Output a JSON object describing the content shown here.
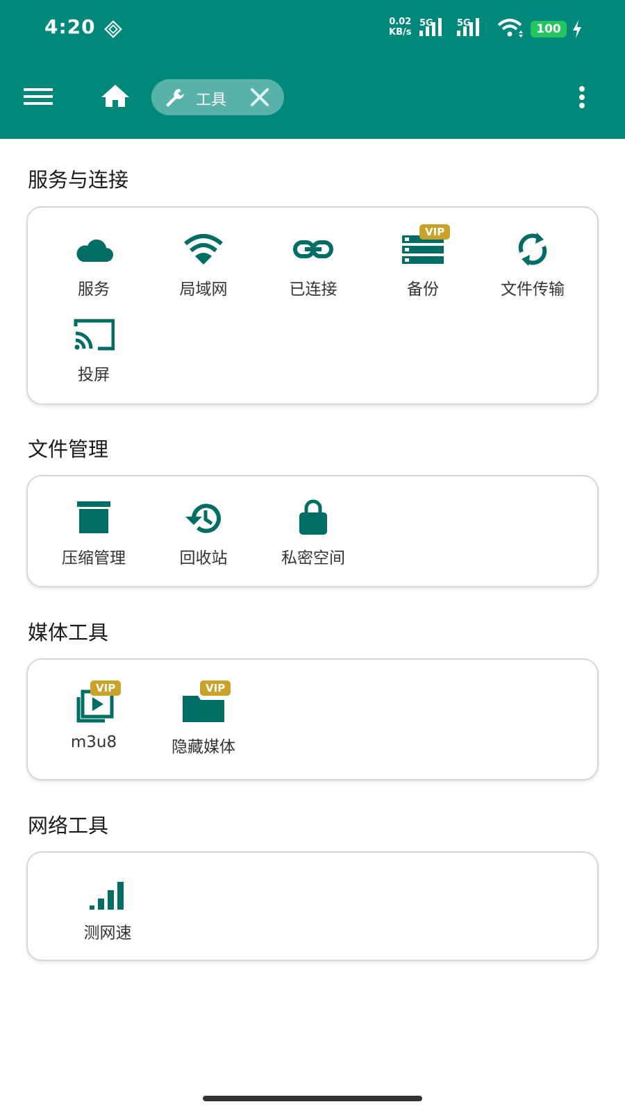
{
  "status_bar": {
    "time": "4:20",
    "net_speed_value": "0.02",
    "net_speed_unit": "KB/s",
    "sim1": "5G",
    "sim2": "5G",
    "battery": "100"
  },
  "toolbar": {
    "chip_label": "工具"
  },
  "colors": {
    "primary": "#00897B",
    "icon": "#006E64",
    "vip_badge": "#C9A227",
    "battery": "#22C55E"
  },
  "sections": [
    {
      "title": "服务与连接",
      "items": [
        {
          "label": "服务",
          "icon": "cloud-icon"
        },
        {
          "label": "局域网",
          "icon": "wifi-icon"
        },
        {
          "label": "已连接",
          "icon": "link-icon"
        },
        {
          "label": "备份",
          "icon": "server-icon",
          "badge": "VIP"
        },
        {
          "label": "文件传输",
          "icon": "sync-icon"
        },
        {
          "label": "投屏",
          "icon": "cast-icon"
        }
      ]
    },
    {
      "title": "文件管理",
      "items": [
        {
          "label": "压缩管理",
          "icon": "archive-icon"
        },
        {
          "label": "回收站",
          "icon": "history-icon"
        },
        {
          "label": "私密空间",
          "icon": "lock-icon"
        }
      ]
    },
    {
      "title": "媒体工具",
      "items": [
        {
          "label": "m3u8",
          "icon": "video-library-icon",
          "badge": "VIP"
        },
        {
          "label": "隐藏媒体",
          "icon": "folder-icon",
          "badge": "VIP"
        }
      ]
    },
    {
      "title": "网络工具",
      "items": [
        {
          "label": "测网速",
          "icon": "signal-bars-icon"
        }
      ]
    }
  ]
}
